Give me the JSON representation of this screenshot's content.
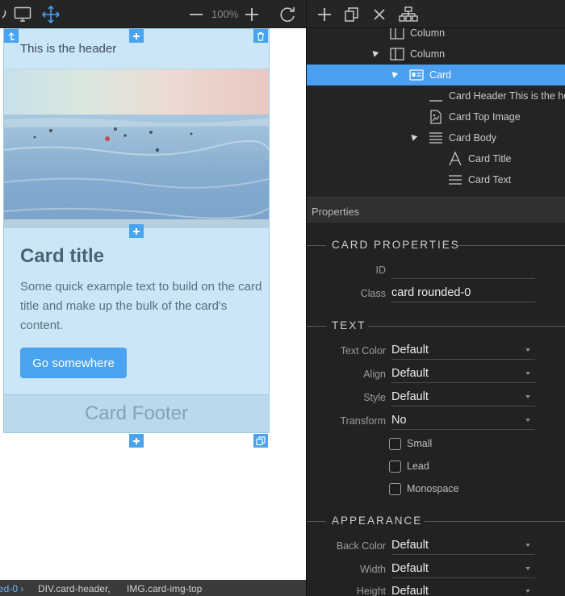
{
  "colors": {
    "accent": "#4a9ff0",
    "card_bg": "#cbe6f7",
    "panel_bg": "#222222",
    "toolbar_bg": "#252525"
  },
  "left_toolbar": {
    "icons": [
      "comma-icon",
      "desktop-icon",
      "move-icon",
      "zoom-out-icon",
      "zoom-in-icon",
      "refresh-icon"
    ],
    "zoom_label": "100%"
  },
  "card": {
    "header_text": "This is the header",
    "title": "Card title",
    "text": "Some quick example text to build on the card title and make up the bulk of the card's content.",
    "button_label": "Go somewhere",
    "footer_text": "Card Footer",
    "handles": [
      "move-up-icon",
      "add-icon",
      "trash-icon",
      "add-icon",
      "add-icon",
      "copy-icon"
    ]
  },
  "breadcrumb": {
    "items": [
      "ed-0 ›",
      "DIV.card-header,",
      "IMG.card-img-top"
    ]
  },
  "right_toolbar": {
    "icons": [
      "add-icon",
      "duplicate-icon",
      "close-icon",
      "hierarchy-icon"
    ]
  },
  "tree": {
    "items": [
      {
        "label": "Column",
        "icon": "column-icon",
        "expanded": false,
        "selected": false
      },
      {
        "label": "Column",
        "icon": "column-icon",
        "expanded": true,
        "selected": false
      },
      {
        "label": "Card",
        "icon": "card-icon",
        "expanded": true,
        "selected": true
      },
      {
        "label": "Card Header This is the he",
        "icon": "header-line-icon",
        "expanded": false,
        "selected": false
      },
      {
        "label": "Card Top Image",
        "icon": "image-icon",
        "expanded": false,
        "selected": false
      },
      {
        "label": "Card Body",
        "icon": "lines-icon",
        "expanded": true,
        "selected": false
      },
      {
        "label": "Card Title",
        "icon": "text-a-icon",
        "expanded": false,
        "selected": false
      },
      {
        "label": "Card Text",
        "icon": "lines-icon",
        "expanded": false,
        "selected": false
      }
    ]
  },
  "properties": {
    "header": "Properties",
    "card_section": "CARD PROPERTIES",
    "id_label": "ID",
    "id_value": "",
    "class_label": "Class",
    "class_value": "card rounded-0",
    "text_section": "TEXT",
    "text_color_label": "Text Color",
    "text_color_value": "Default",
    "align_label": "Align",
    "align_value": "Default",
    "style_label": "Style",
    "style_value": "Default",
    "transform_label": "Transform",
    "transform_value": "No",
    "small_label": "Small",
    "small_checked": false,
    "lead_label": "Lead",
    "lead_checked": false,
    "monospace_label": "Monospace",
    "monospace_checked": false,
    "appearance_section": "APPEARANCE",
    "back_color_label": "Back Color",
    "back_color_value": "Default",
    "width_label": "Width",
    "width_value": "Default",
    "height_label": "Height",
    "height_value": "Default"
  }
}
